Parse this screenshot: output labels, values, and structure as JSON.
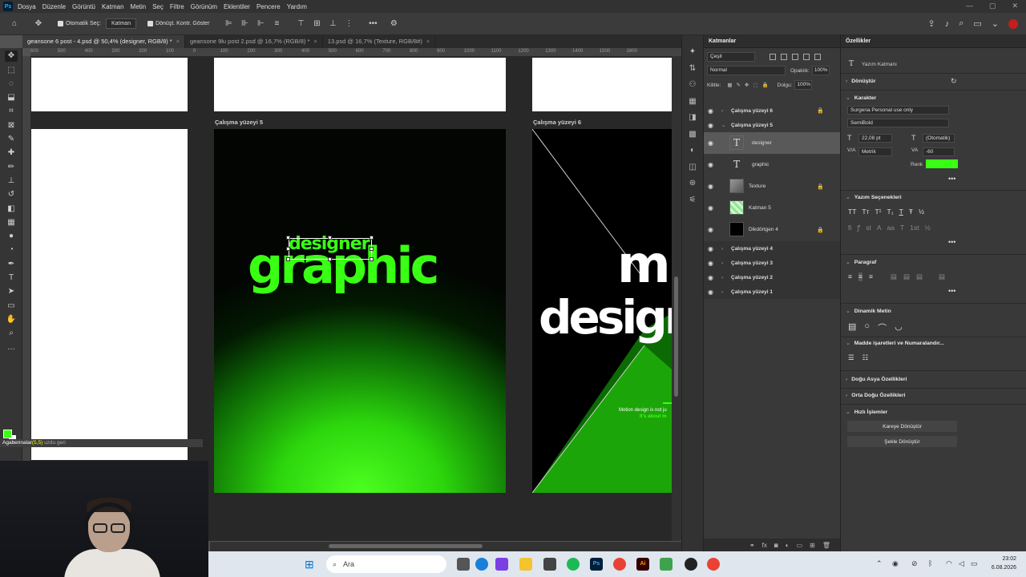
{
  "menubar": {
    "app_icon": "Ps",
    "items": [
      "Dosya",
      "Düzenle",
      "Görüntü",
      "Katman",
      "Metin",
      "Seç",
      "Filtre",
      "Görünüm",
      "Eklentiler",
      "Pencere",
      "Yardım"
    ]
  },
  "options": {
    "auto_select_label": "Otomatik Seç:",
    "auto_select_value": "Katman",
    "transform_label": "Dönüşt. Kontr. Göster"
  },
  "tabs": [
    {
      "label": "geansone 6 post - 4.psd @ 50,4% (designer, RGB/8) *",
      "active": true
    },
    {
      "label": "geansone 9lu post 2.psd @ 16,7% (RGB/8) *",
      "active": false
    },
    {
      "label": "13.psd @ 16,7% (Texture, RGB/8#)",
      "active": false
    }
  ],
  "ruler_ticks": [
    "600",
    "500",
    "400",
    "300",
    "200",
    "100",
    "0",
    "100",
    "200",
    "300",
    "400",
    "500",
    "600",
    "700",
    "800",
    "900",
    "1000",
    "1100",
    "1200",
    "1300",
    "1400",
    "1500",
    "1600"
  ],
  "canvas": {
    "artboard5_label": "Çalışma yüzeyi 5",
    "artboard6_label": "Çalışma yüzeyi 6",
    "art_graphic": "graphic",
    "art_designer": "designer",
    "art6_line1": "m",
    "art6_line2": "design",
    "art6_small1": "Motion design is not ju",
    "art6_small2": "It's about m"
  },
  "layers_panel": {
    "title": "Katmanlar",
    "filter": "Çeşit",
    "blend_mode": "Normal",
    "opacity_label": "Opaklık:",
    "opacity_value": "100%",
    "lock_label": "Kilitle:",
    "fill_label": "Dolgu:",
    "fill_value": "100%",
    "layers": [
      {
        "name": "Çalışma yüzeyi 6",
        "kind": "group",
        "locked": true
      },
      {
        "name": "Çalışma yüzeyi 5",
        "kind": "group-open",
        "locked": false
      },
      {
        "name": "designer",
        "kind": "text",
        "selected": true
      },
      {
        "name": "graphic",
        "kind": "text"
      },
      {
        "name": "Texture",
        "kind": "image",
        "locked": true
      },
      {
        "name": "Katman 5",
        "kind": "image"
      },
      {
        "name": "Dikdörtgen 4",
        "kind": "shape",
        "locked": true
      },
      {
        "name": "Çalışma yüzeyi 4",
        "kind": "group"
      },
      {
        "name": "Çalışma yüzeyi 3",
        "kind": "group"
      },
      {
        "name": "Çalışma yüzeyi 2",
        "kind": "group"
      },
      {
        "name": "Çalışma yüzeyi 1",
        "kind": "group"
      }
    ]
  },
  "properties": {
    "title": "Özellikler",
    "layer_type": "Yazım Katmanı",
    "transform": "Dönüştür",
    "character": "Karakter",
    "font_family": "Surgena Personal use only",
    "font_style": "SemiBold",
    "font_size": "22,08 pt",
    "leading": "(Otomatik)",
    "kerning": "Metrik",
    "tracking": "-60",
    "color_label": "Renk",
    "color": "#39ff14",
    "type_options": "Yazım Seçenekleri",
    "paragraph": "Paragraf",
    "dynamic_text": "Dinamik Metin",
    "bullets": "Madde işaretleri ve Numaralandır...",
    "east_asian": "Doğu Asya Özellikleri",
    "middle_eastern": "Orta Doğu Özellikleri",
    "quick_actions": "Hızlı İşlemler",
    "btn_to_square": "Kareye Dönüştür",
    "btn_to_shape": "Şekle Dönüştür"
  },
  "taskbar": {
    "search_placeholder": "Ara",
    "time": "23:02",
    "date": "6.08.2026"
  },
  "ticker": {
    "name": "Agabennalar",
    "mid": "(5,5)",
    "rest": "uzdu geri"
  }
}
